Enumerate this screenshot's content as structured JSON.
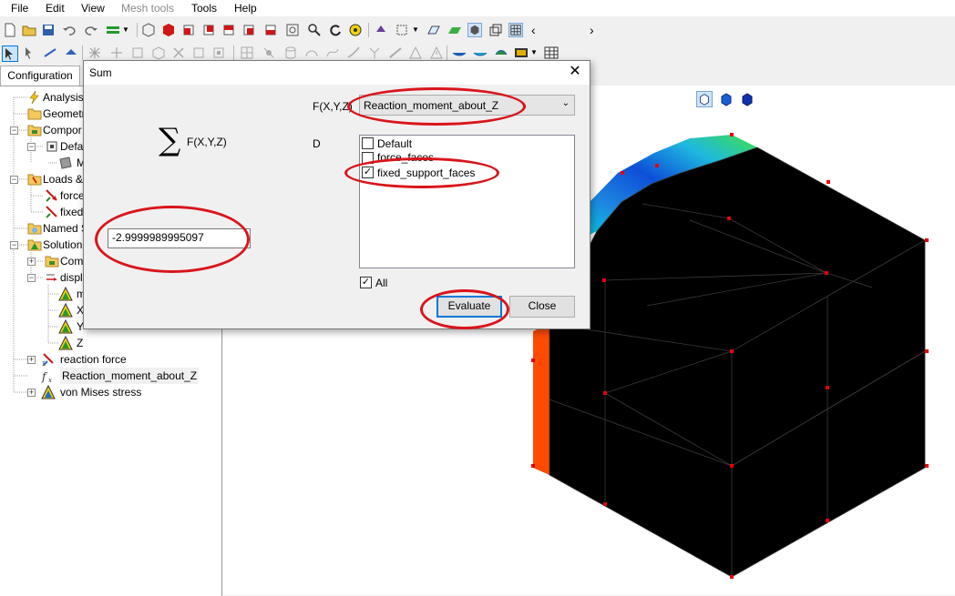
{
  "menubar": {
    "file": "File",
    "edit": "Edit",
    "view": "View",
    "mesh_tools": "Mesh tools",
    "tools": "Tools",
    "help": "Help"
  },
  "tabs": {
    "configuration": "Configuration"
  },
  "tree": {
    "analysis": "Analysis",
    "geometry": "Geometr",
    "components": "Compor",
    "default": "Defau",
    "mesh": "M",
    "loads": "Loads &",
    "force": "force",
    "fixed": "fixed",
    "named_selections": "Named S",
    "solution": "Solution",
    "comp": "Com",
    "displacement": "displ",
    "disp_m": "m",
    "disp_x": "X",
    "disp_y": "Y",
    "disp_z": "Z",
    "reaction_force": "reaction force",
    "reaction_moment": "Reaction_moment_about_Z",
    "von_mises": "von Mises stress"
  },
  "dialog": {
    "title": "Sum",
    "formula_label": "F(X,Y,Z)",
    "field_label": "F(X,Y,Z)",
    "selected_function": "Reaction_moment_about_Z",
    "domain_label": "D",
    "domain_options": [
      {
        "label": "Default",
        "checked": false
      },
      {
        "label": "force_faces",
        "checked": false
      },
      {
        "label": "fixed_support_faces",
        "checked": true
      }
    ],
    "all_label": "All",
    "all_checked": true,
    "result_value": "-2.9999989995097",
    "evaluate_label": "Evaluate",
    "close_label": "Close"
  },
  "colors": {
    "annotation": "#d9151b",
    "accent": "#0078d7",
    "mesh_face": "#000000",
    "mesh_node": "#e8000c",
    "contour_orange": "#ff4a00"
  }
}
